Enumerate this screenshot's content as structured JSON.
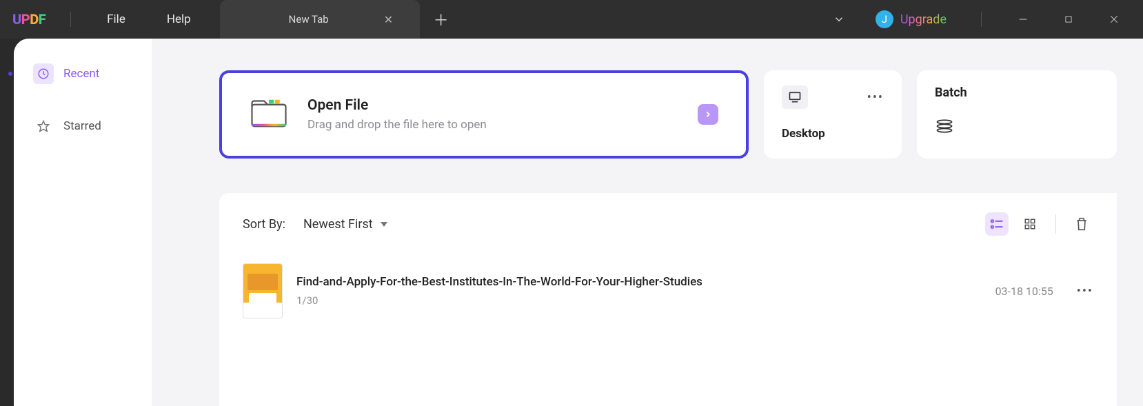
{
  "titlebar": {
    "menus": {
      "file": "File",
      "help": "Help"
    },
    "tab_label": "New Tab",
    "avatar_letter": "J",
    "upgrade_label": "Upgrade"
  },
  "sidebar": {
    "items": [
      {
        "label": "Recent"
      },
      {
        "label": "Starred"
      }
    ]
  },
  "open_file": {
    "title": "Open File",
    "subtitle": "Drag and drop the file here to open"
  },
  "desktop_card": {
    "label": "Desktop"
  },
  "batch_card": {
    "label": "Batch"
  },
  "sort": {
    "label": "Sort By:",
    "selected": "Newest First"
  },
  "files": [
    {
      "title": "Find-and-Apply-For-the-Best-Institutes-In-The-World-For-Your-Higher-Studies",
      "pages": "1/30",
      "date": "03-18 10:55"
    }
  ]
}
